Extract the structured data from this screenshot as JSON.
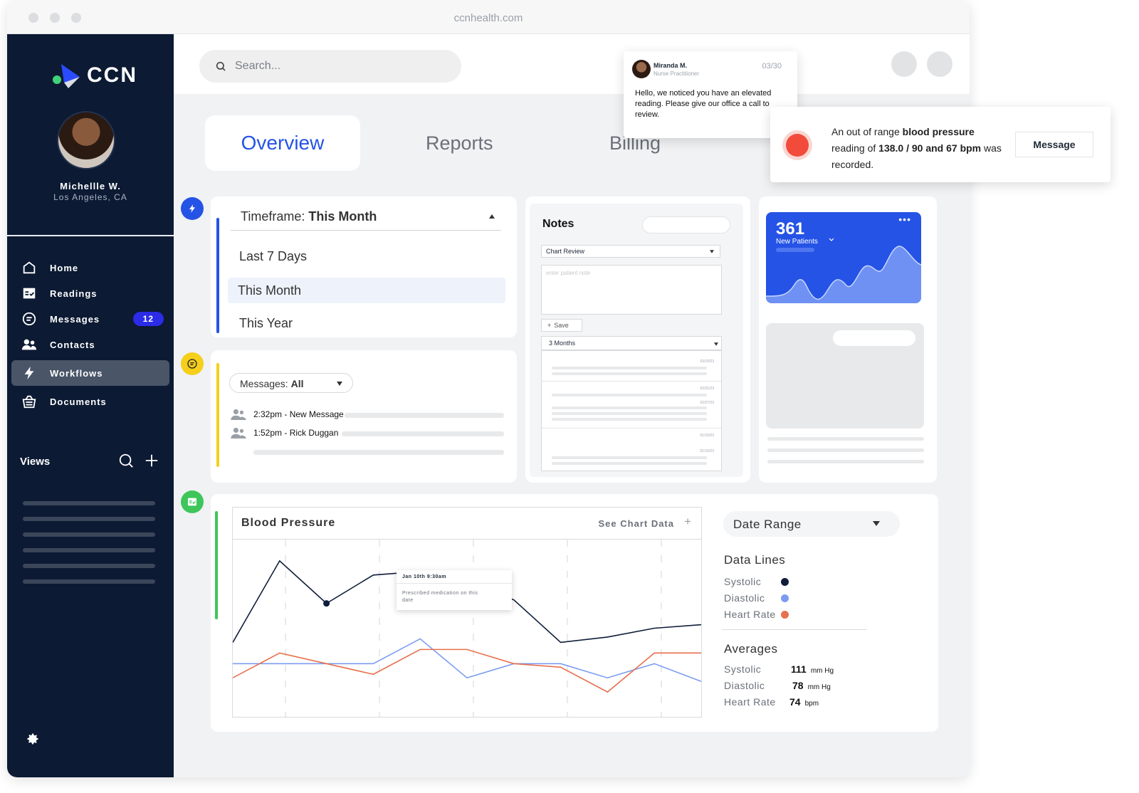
{
  "window": {
    "url": "ccnhealth.com"
  },
  "sidebar": {
    "brand": "CCN",
    "user": {
      "name": "Michellle W.",
      "location": "Los Angeles, CA"
    },
    "nav": [
      {
        "label": "Home",
        "icon": "home-icon"
      },
      {
        "label": "Readings",
        "icon": "readings-icon"
      },
      {
        "label": "Messages",
        "icon": "messages-icon",
        "badge": "12"
      },
      {
        "label": "Contacts",
        "icon": "contacts-icon"
      },
      {
        "label": "Workflows",
        "icon": "bolt-icon",
        "active": true
      },
      {
        "label": "Documents",
        "icon": "documents-icon"
      }
    ],
    "views_label": "Views"
  },
  "search": {
    "placeholder": "Search..."
  },
  "tabs": {
    "overview": "Overview",
    "reports": "Reports",
    "billing": "Billing"
  },
  "notification": {
    "sender": "Miranda M.",
    "role": "Nurse Practitioner",
    "date": "03/30",
    "body": "Hello, we noticed you have an elevated reading. Please give our office a call to review."
  },
  "alert": {
    "prefix": "An out of range ",
    "bold1": "blood pressure",
    "mid": "reading of ",
    "bold2": "138.0 / 90 and 67 bpm",
    "suffix": "was recorded.",
    "button": "Message"
  },
  "timeframe": {
    "label": "Timeframe: ",
    "value": "This Month",
    "options": [
      "Last 7 Days",
      "This Month",
      "This Year"
    ]
  },
  "messages_card": {
    "filter_label": "Messages: ",
    "filter_value": "All",
    "items": [
      {
        "text": "2:32pm - New Message"
      },
      {
        "text": "1:52pm - Rick Duggan"
      }
    ]
  },
  "notes": {
    "title": "Notes",
    "select": "Chart Review",
    "placeholder": "enter patient note",
    "save": "Save",
    "range": "3 Months",
    "dates": [
      "03/10/23",
      "02/31/23",
      "02/27/23",
      "01/15/23",
      "01/10/23"
    ]
  },
  "patients": {
    "count": "361",
    "label": "New Patients"
  },
  "bp_chart": {
    "title": "Blood Pressure",
    "see_data": "See Chart Data",
    "tooltip_title": "Jan 10th 9:30am",
    "tooltip_body": "Prescribed medication on this date"
  },
  "chart_data": {
    "type": "line",
    "title": "Blood Pressure",
    "x": [
      0,
      1,
      2,
      3,
      4,
      5,
      6,
      7,
      8,
      9,
      10
    ],
    "series": [
      {
        "name": "Systolic",
        "color": "#0f1d3a",
        "values": [
          42,
          88,
          64,
          80,
          82,
          76,
          66,
          42,
          45,
          50,
          52
        ]
      },
      {
        "name": "Diastolic",
        "color": "#7c9cf0",
        "values": [
          30,
          30,
          30,
          30,
          44,
          22,
          30,
          30,
          22,
          30,
          20
        ]
      },
      {
        "name": "Heart Rate",
        "color": "#e8704e",
        "values": [
          22,
          36,
          30,
          24,
          38,
          38,
          30,
          28,
          14,
          36,
          36
        ]
      }
    ],
    "ylim": [
      0,
      100
    ]
  },
  "side_panel": {
    "date_range": "Date Range",
    "data_lines_title": "Data Lines",
    "lines": [
      {
        "label": "Systolic",
        "color": "#0f1d3a"
      },
      {
        "label": "Diastolic",
        "color": "#7c9cf0"
      },
      {
        "label": "Heart Rate",
        "color": "#e8704e"
      }
    ],
    "averages_title": "Averages",
    "averages": [
      {
        "label": "Systolic",
        "value": "111",
        "unit": "mm Hg"
      },
      {
        "label": "Diastolic",
        "value": "78",
        "unit": "mm Hg"
      },
      {
        "label": "Heart Rate",
        "value": "74",
        "unit": "bpm"
      }
    ]
  }
}
